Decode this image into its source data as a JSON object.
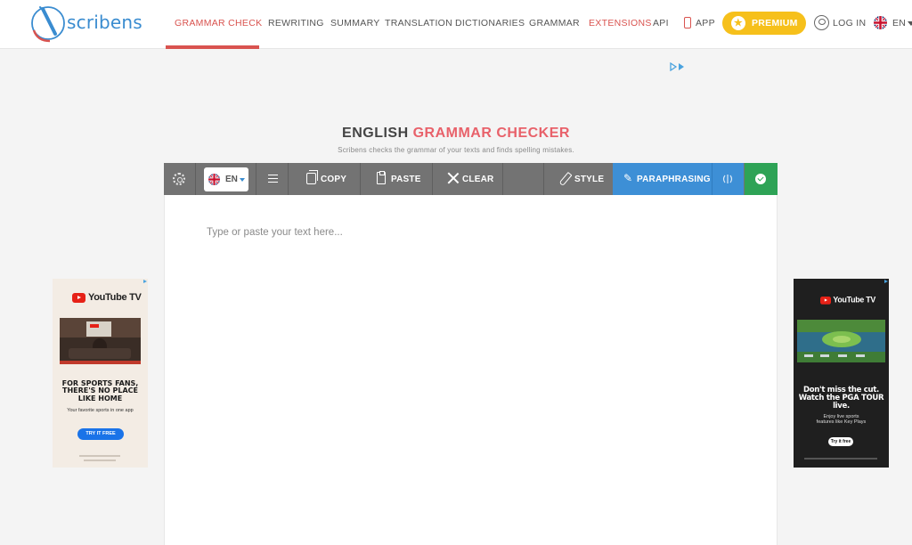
{
  "header": {
    "logo_text": "scribens",
    "nav": [
      {
        "label": "GRAMMAR CHECK",
        "active": true
      },
      {
        "label": "REWRITING"
      },
      {
        "label": "SUMMARY"
      },
      {
        "label": "TRANSLATION"
      },
      {
        "label": "DICTIONARIES"
      },
      {
        "label": "GRAMMAR"
      },
      {
        "label": "EXTENSIONS",
        "highlight": true
      },
      {
        "label": "API"
      },
      {
        "label": "APP"
      }
    ],
    "premium_label": "PREMIUM",
    "login_label": "LOG IN",
    "language_label": "EN"
  },
  "hero": {
    "title_part1": "ENGLISH ",
    "title_part2": "GRAMMAR CHECKER",
    "subtitle": "Scribens checks the grammar of your texts and finds spelling mistakes."
  },
  "toolbar": {
    "language": "EN",
    "copy": "COPY",
    "paste": "PASTE",
    "clear": "CLEAR",
    "style": "STYLE",
    "paraphrasing": "PARAPHRASING"
  },
  "editor": {
    "placeholder": "Type or paste your text here..."
  },
  "ads": {
    "left": {
      "brand": "YouTube TV",
      "headline_lines": [
        "FOR SPORTS FANS,",
        "THERE'S NO PLACE",
        "LIKE HOME"
      ],
      "tagline": "Your favorite sports in one app",
      "cta": "TRY IT FREE"
    },
    "right": {
      "brand": "YouTube TV",
      "headline_lines": [
        "Don't miss the cut.",
        "Watch the PGA TOUR live."
      ],
      "tagline_lines": [
        "Enjoy live sports",
        "features like Key Plays"
      ],
      "cta": "Try it free"
    }
  },
  "colors": {
    "brand_blue": "#3a8cd0",
    "accent_red": "#d9534f",
    "premium_yellow": "#f6c01b",
    "toolbar_gray": "#737373",
    "paraphrasing_blue": "#3d8fd6",
    "check_green": "#2ea356"
  }
}
